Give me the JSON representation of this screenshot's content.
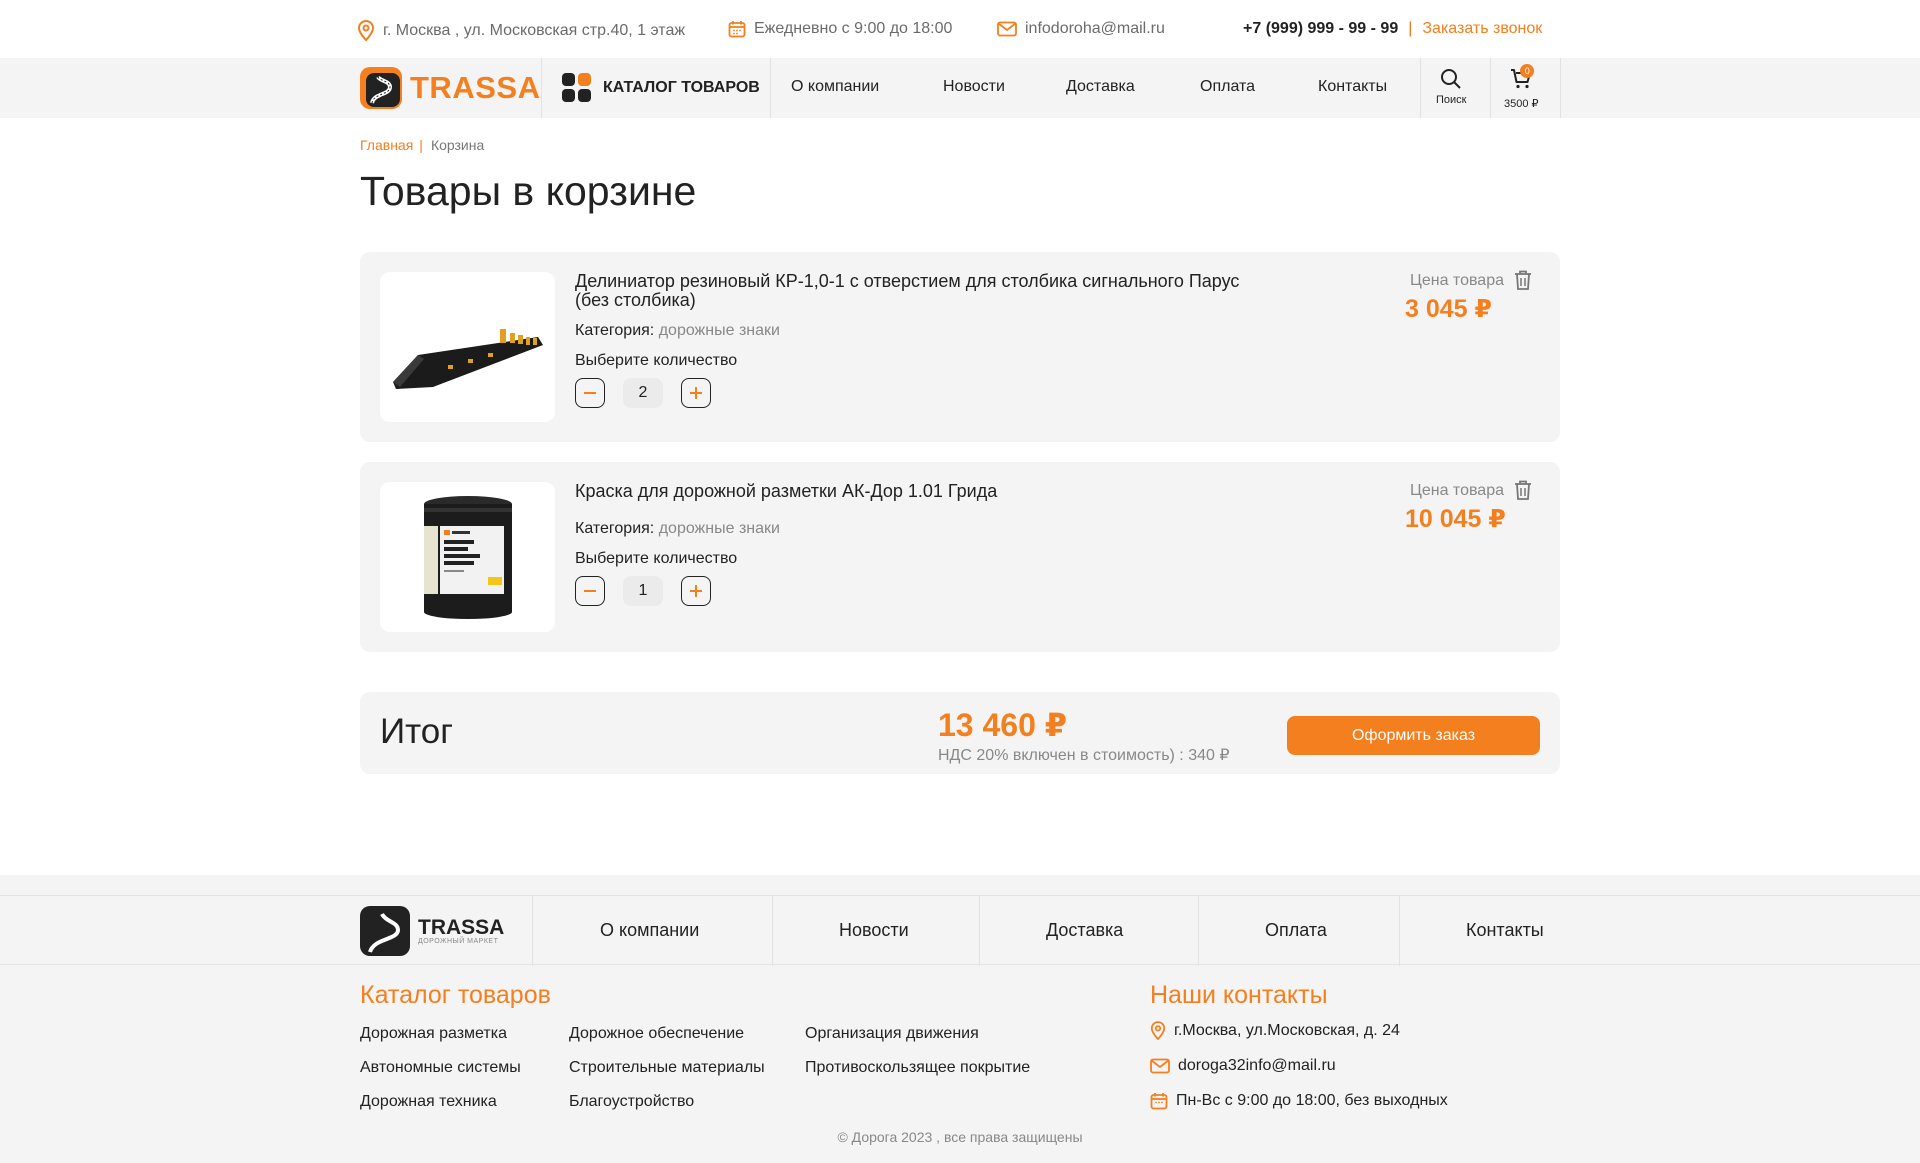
{
  "topbar": {
    "address": "г. Москва , ул. Московская стр.40, 1 этаж",
    "hours": "Ежедневно с 9:00 до 18:00",
    "email": "infodoroha@mail.ru",
    "phone": "+7 (999) 999  - 99 - 99",
    "callback": "Заказать звонок"
  },
  "nav": {
    "logo": "TRASSA",
    "catalog": "КАТАЛОГ ТОВАРОВ",
    "links": [
      "О компании",
      "Новости",
      "Доставка",
      "Оплата",
      "Контакты"
    ],
    "search_label": "Поиск",
    "cart_total": "3500 ₽",
    "cart_count": "0"
  },
  "breadcrumb": {
    "home": "Главная",
    "sep": "|",
    "current": "Корзина"
  },
  "page_title": "Товары в корзине",
  "cart": {
    "category_label": "Категория:",
    "choose_qty": "Выберите количество",
    "price_label": "Цена товара",
    "items": [
      {
        "name": "Делиниатор резиновый КР-1,0-1 с отверстием для столбика сигнального Парус (без столбика)",
        "category": "дорожные знаки",
        "qty": "2",
        "price": "3 045 ₽"
      },
      {
        "name": "Краска для дорожной разметки АК-Дор 1.01 Грида",
        "category": "дорожные знаки",
        "qty": "1",
        "price": "10 045 ₽"
      }
    ]
  },
  "total": {
    "label": "Итог",
    "sum": "13 460 ₽",
    "vat": "НДС 20% включен в стоимость) :   340 ₽",
    "order_button": "Оформить заказ"
  },
  "footer": {
    "logo": "TRASSA",
    "logo_sub": "ДОРОЖНЫЙ МАРКЕТ",
    "links": [
      "О компании",
      "Новости",
      "Доставка",
      "Оплата",
      "Контакты"
    ],
    "catalog_title": "Каталог товаров",
    "catalog": [
      "Дорожная разметка",
      "Автономные системы",
      "Дорожная техника",
      "Дорожное обеспечение",
      "Строительные материалы",
      "Благоустройство",
      "Организация движения",
      "Противоскользящее покрытие"
    ],
    "contacts_title": "Наши контакты",
    "address": "г.Москва, ул.Московская, д. 24",
    "email": "doroga32info@mail.ru",
    "hours": "Пн-Вс с 9:00 до 18:00, без выходных",
    "copyright": "© Дорога 2023 , все права защищены"
  },
  "colors": {
    "accent": "#f47f1f",
    "panel": "#f4f4f4",
    "text": "#222222"
  }
}
